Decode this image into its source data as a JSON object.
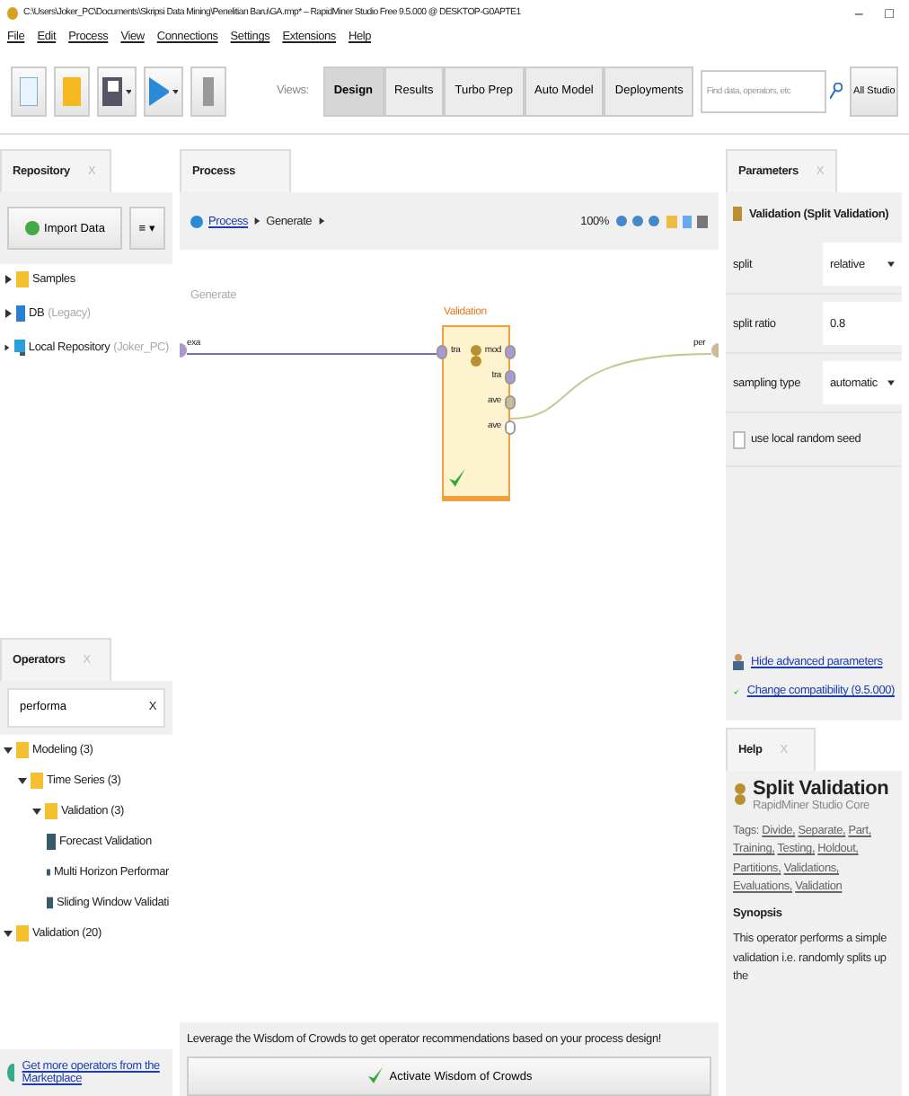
{
  "window": {
    "title": "C:\\Users\\Joker_PC\\Documents\\Skripsi Data Mining\\Penelitian Baru\\GA.rmp* – RapidMiner Studio Free 9.5.000 @ DESKTOP-G0APTE1",
    "controls": [
      "–",
      "□"
    ]
  },
  "menu": [
    "File",
    "Edit",
    "Process",
    "View",
    "Connections",
    "Settings",
    "Extensions",
    "Help"
  ],
  "toolbar": {
    "views_label": "Views:",
    "views": [
      {
        "label": "Design",
        "selected": true
      },
      {
        "label": "Results",
        "selected": false
      },
      {
        "label": "Turbo Prep",
        "selected": false
      },
      {
        "label": "Auto Model",
        "selected": false
      },
      {
        "label": "Deployments",
        "selected": false
      }
    ],
    "search": {
      "placeholder": "Find data, operators, etc"
    },
    "studio_button": "All Studio"
  },
  "repository": {
    "title": "Repository",
    "close": "X",
    "import_button": "Import Data",
    "menu_button": "≡ ▾",
    "items": [
      {
        "label": "Samples",
        "kind": "folder",
        "expanded": false
      },
      {
        "label": "DB",
        "note": "(Legacy)",
        "kind": "database",
        "expanded": false
      },
      {
        "label": "Local Repository",
        "note": "(Joker_PC)",
        "kind": "computer",
        "expanded": false
      }
    ]
  },
  "operators": {
    "title": "Operators",
    "close": "X",
    "search": {
      "value": "performa",
      "clear": "X"
    },
    "tree": [
      {
        "label": "Modeling (3)",
        "kind": "folder",
        "expanded": true,
        "children": [
          {
            "label": "Time Series (3)",
            "kind": "folder",
            "expanded": true,
            "children": [
              {
                "label": "Validation (3)",
                "kind": "folder",
                "expanded": true,
                "children": [
                  {
                    "label": "Forecast Validation",
                    "kind": "operator"
                  },
                  {
                    "label": "Multi Horizon Performar",
                    "kind": "operator"
                  },
                  {
                    "label": "Sliding Window Validati",
                    "kind": "operator"
                  }
                ]
              }
            ]
          }
        ]
      },
      {
        "label": "Validation (20)",
        "kind": "folder",
        "expanded": true
      }
    ],
    "marketplace_link": "Get more operators from the Marketplace"
  },
  "process": {
    "title": "Process",
    "breadcrumb": [
      "Process",
      "Generate"
    ],
    "zoom": "100%",
    "canvas_label": "Generate",
    "input_port": "exa",
    "output_port": "per",
    "operator": {
      "name": "Validation",
      "input_ports": [
        "tra"
      ],
      "output_ports": [
        {
          "label": "mod",
          "connected": false
        },
        {
          "label": "tra",
          "connected": false
        },
        {
          "label": "ave",
          "connected": true
        },
        {
          "label": "ave",
          "connected": false
        }
      ],
      "valid": true
    },
    "wisdom_text": "Leverage the Wisdom of Crowds to get operator recommendations based on your process design!",
    "wisdom_button": "Activate Wisdom of Crowds"
  },
  "parameters": {
    "title": "Parameters",
    "close": "X",
    "operator": "Validation (Split Validation)",
    "rows": [
      {
        "label": "split",
        "kind": "select",
        "value": "relative"
      },
      {
        "label": "split ratio",
        "kind": "text",
        "value": "0.8"
      },
      {
        "label": "sampling type",
        "kind": "select",
        "value": "automatic"
      },
      {
        "label": "use local random seed",
        "kind": "checkbox",
        "checked": false
      }
    ],
    "links": [
      "Hide advanced parameters",
      "Change compatibility (9.5.000)"
    ]
  },
  "help": {
    "title": "Help",
    "close": "X",
    "heading": "Split Validation",
    "subheading": "RapidMiner Studio Core",
    "tags_label": "Tags:",
    "tags": [
      "Divide,",
      "Separate,",
      "Part,",
      "Training,",
      "Testing,",
      "Holdout,",
      "Partitions,",
      "Validations,",
      "Evaluations,",
      "Validation"
    ],
    "synopsis_title": "Synopsis",
    "synopsis": "This operator performs a simple validation i.e. randomly splits up the"
  }
}
